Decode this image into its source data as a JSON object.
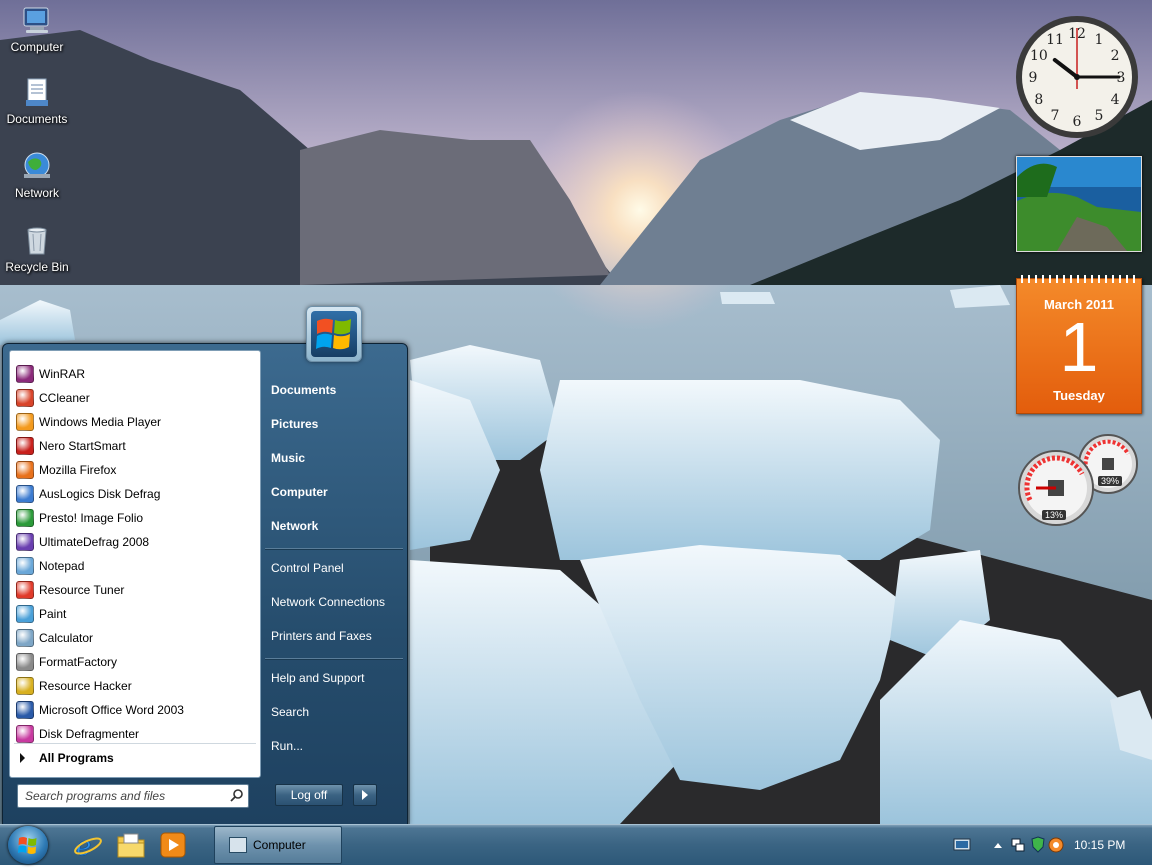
{
  "desktop_icons": [
    {
      "label": "Computer",
      "icon": "computer-icon"
    },
    {
      "label": "Documents",
      "icon": "documents-icon"
    },
    {
      "label": "Network",
      "icon": "network-icon"
    },
    {
      "label": "Recycle Bin",
      "icon": "recycle-bin-icon"
    }
  ],
  "gadgets": {
    "clock": {
      "hour": 10,
      "minute": 15,
      "numerals": [
        "12",
        "1",
        "2",
        "3",
        "4",
        "5",
        "6",
        "7",
        "8",
        "9",
        "10",
        "11"
      ]
    },
    "calendar": {
      "month_year": "March 2011",
      "day": "1",
      "weekday": "Tuesday"
    },
    "cpu_meter": {
      "cpu_percent": "13%",
      "memory_percent": "39%"
    }
  },
  "start_menu": {
    "programs": [
      {
        "label": "WinRAR",
        "icon": "winrar-icon",
        "color": "#8b2a7a"
      },
      {
        "label": "CCleaner",
        "icon": "ccleaner-icon",
        "color": "#d8442a"
      },
      {
        "label": "Windows Media Player",
        "icon": "media-player-icon",
        "color": "#f39a1e"
      },
      {
        "label": "Nero StartSmart",
        "icon": "nero-icon",
        "color": "#c8201c"
      },
      {
        "label": "Mozilla Firefox",
        "icon": "firefox-icon",
        "color": "#e8711c"
      },
      {
        "label": "AusLogics Disk Defrag",
        "icon": "disk-defrag-icon",
        "color": "#3c7bd0"
      },
      {
        "label": "Presto! Image Folio",
        "icon": "image-folio-icon",
        "color": "#2c9a3a"
      },
      {
        "label": "UltimateDefrag 2008",
        "icon": "ultimatedefrag-icon",
        "color": "#6a3fb0"
      },
      {
        "label": "Notepad",
        "icon": "notepad-icon",
        "color": "#6aa7d8"
      },
      {
        "label": "Resource Tuner",
        "icon": "resource-tuner-icon",
        "color": "#e03a2a"
      },
      {
        "label": "Paint",
        "icon": "paint-icon",
        "color": "#4aa0d8"
      },
      {
        "label": "Calculator",
        "icon": "calculator-icon",
        "color": "#7ea6c6"
      },
      {
        "label": "FormatFactory",
        "icon": "formatfactory-icon",
        "color": "#8a8a8a"
      },
      {
        "label": "Resource Hacker",
        "icon": "resource-hacker-icon",
        "color": "#d8b020"
      },
      {
        "label": "Microsoft Office Word 2003",
        "icon": "word-icon",
        "color": "#2a5aa8"
      },
      {
        "label": "Disk Defragmenter",
        "icon": "disk-defragmenter-icon",
        "color": "#c83aa0"
      }
    ],
    "all_programs": "All Programs",
    "search_placeholder": "Search programs and files",
    "right_links_primary": [
      "Documents",
      "Pictures",
      "Music",
      "Computer",
      "Network"
    ],
    "right_links_secondary": [
      "Control Panel",
      "Network Connections",
      "Printers and Faxes"
    ],
    "right_links_tertiary": [
      "Help and Support",
      "Search",
      "Run..."
    ],
    "logoff_label": "Log off"
  },
  "taskbar": {
    "quicklaunch": [
      {
        "icon": "internet-explorer-icon"
      },
      {
        "icon": "file-explorer-icon"
      },
      {
        "icon": "media-player-icon"
      }
    ],
    "open_windows": [
      {
        "label": "Computer",
        "icon": "computer-icon"
      }
    ],
    "clock": "10:15 PM"
  }
}
